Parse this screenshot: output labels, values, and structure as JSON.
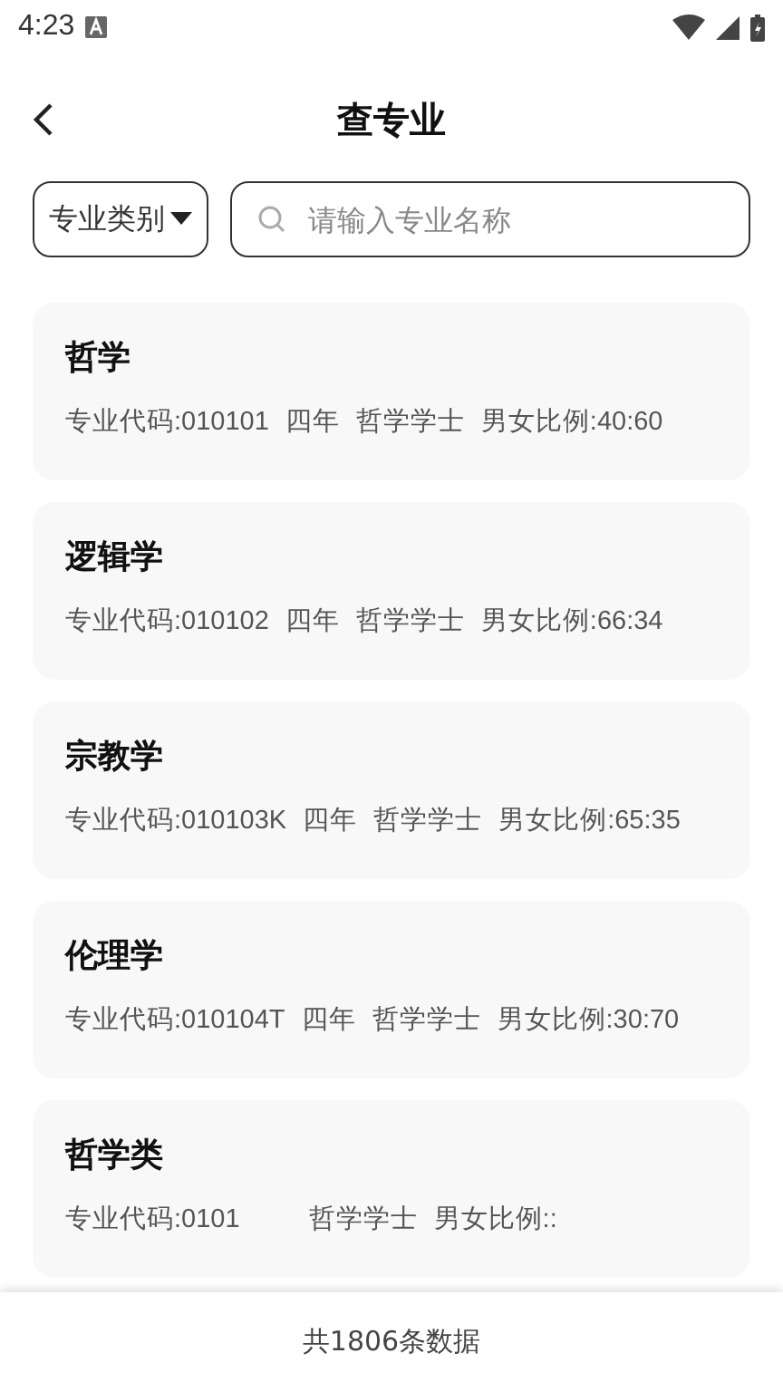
{
  "status_bar": {
    "time": "4:23"
  },
  "header": {
    "title": "查专业"
  },
  "filter": {
    "category": "专业类别",
    "search_placeholder": "请输入专业名称"
  },
  "majors": [
    {
      "name": "哲学",
      "code": "专业代码:010101",
      "years": "四年",
      "degree": "哲学学士",
      "ratio": "男女比例:40:60"
    },
    {
      "name": "逻辑学",
      "code": "专业代码:010102",
      "years": "四年",
      "degree": "哲学学士",
      "ratio": "男女比例:66:34"
    },
    {
      "name": "宗教学",
      "code": "专业代码:010103K",
      "years": "四年",
      "degree": "哲学学士",
      "ratio": "男女比例:65:35"
    },
    {
      "name": "伦理学",
      "code": "专业代码:010104T",
      "years": "四年",
      "degree": "哲学学士",
      "ratio": "男女比例:30:70"
    },
    {
      "name": "哲学类",
      "code": "专业代码:0101",
      "degree": "哲学学士",
      "ratio": "男女比例::"
    }
  ],
  "footer": {
    "total": "共1806条数据"
  }
}
